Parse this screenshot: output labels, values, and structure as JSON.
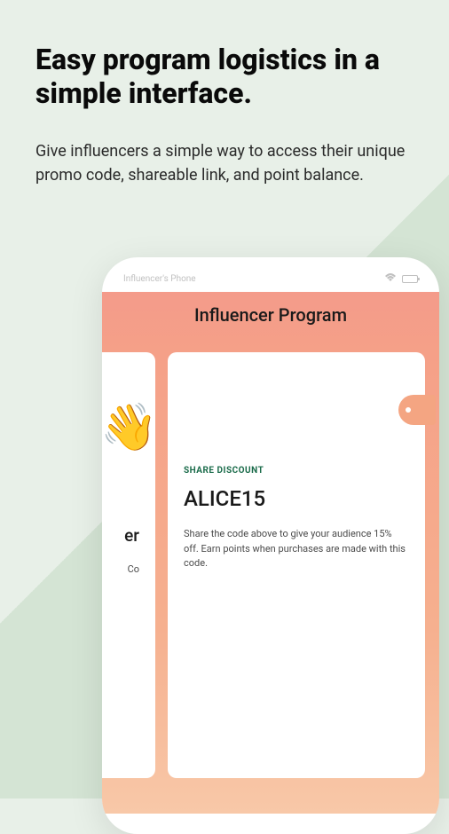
{
  "headline": "Easy program logistics in a simple interface.",
  "description": "Give influencers a simple way to access their unique promo code, shareable link, and point balance.",
  "phone": {
    "status_label": "Influencer's Phone",
    "program_title": "Influencer Program",
    "card_left": {
      "emoji": "👋",
      "text1": "er",
      "text2": "Co"
    },
    "card_right": {
      "share_label": "SHARE DISCOUNT",
      "promo_code": "ALICE15",
      "share_description": "Share the code above to give your audience 15% off. Earn points when purchases are made with this code."
    }
  }
}
